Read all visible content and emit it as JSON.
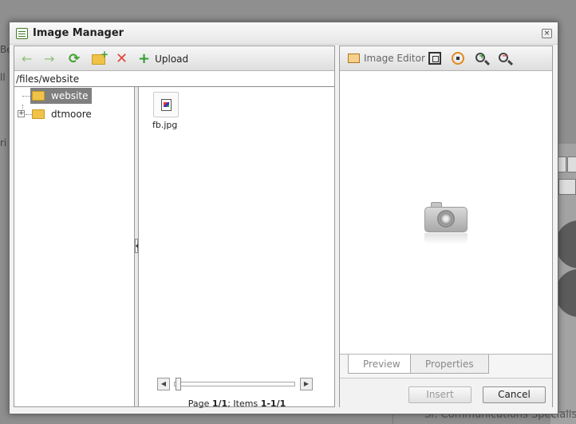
{
  "background": {
    "caption": "Sr. Communications Specialist",
    "fragments": [
      "Be",
      "ll",
      "ri"
    ]
  },
  "dialog": {
    "title": "Image Manager",
    "close_glyph": "×",
    "toolbar": {
      "back_icon": "←",
      "forward_icon": "→",
      "refresh_icon": "⟳",
      "delete_icon": "✕",
      "upload_icon": "+",
      "upload_label": "Upload"
    },
    "path": "/files/website",
    "tree": {
      "expander_glyph": "+",
      "items": [
        {
          "label": "website",
          "selected": true
        },
        {
          "label": "dtmoore",
          "selected": false
        }
      ]
    },
    "files": [
      {
        "name": "fb.jpg"
      }
    ],
    "slider": {
      "left_glyph": "◀",
      "right_glyph": "▶"
    },
    "paging": {
      "page_prefix": "Page ",
      "page_value": "1/1",
      "items_prefix": "; Items ",
      "items_value": "1-1/1"
    },
    "right_toolbar": {
      "image_editor_label": "Image Editor"
    },
    "tabs": [
      {
        "label": "Preview",
        "active": true
      },
      {
        "label": "Properties",
        "active": false
      }
    ],
    "buttons": {
      "insert": "Insert",
      "cancel": "Cancel"
    }
  }
}
